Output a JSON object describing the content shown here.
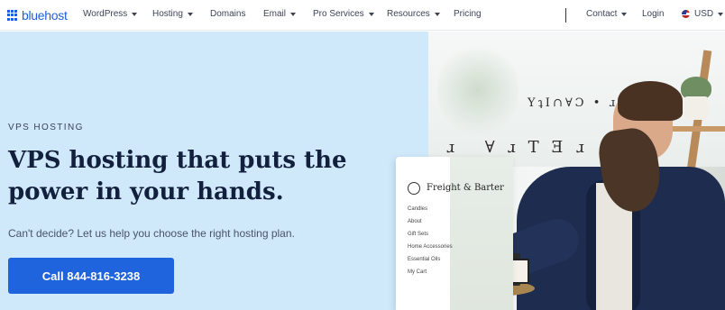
{
  "nav": {
    "logo_text": "bluehost",
    "items": [
      {
        "label": "WordPress",
        "dropdown": true
      },
      {
        "label": "Hosting",
        "dropdown": true
      },
      {
        "label": "Domains",
        "dropdown": false
      },
      {
        "label": "Email",
        "dropdown": true
      },
      {
        "label": "Pro Services",
        "dropdown": true
      },
      {
        "label": "Resources",
        "dropdown": true
      },
      {
        "label": "Pricing",
        "dropdown": false
      }
    ],
    "contact_label": "Contact",
    "login_label": "Login",
    "currency_label": "USD"
  },
  "hero": {
    "eyebrow": "VPS HOSTING",
    "headline": "VPS hosting that puts the power in your hands.",
    "subtext": "Can't decide? Let us help you choose the right hosting plan.",
    "cta_label": "Call 844-816-3238"
  },
  "photo": {
    "sign_line_1": "YʇI∩∀Ɔ • ɹO",
    "sign_line_2": "ɹ ∀ɹTƎɹ",
    "card": {
      "brand": "Freight & Barter",
      "links": [
        "Candles",
        "About",
        "Gift Sets",
        "Home Accessories",
        "Essential Oils",
        "My Cart"
      ]
    }
  },
  "colors": {
    "brand_blue": "#1f63dd",
    "hero_bg": "#cfe9fb",
    "headline": "#13203d"
  }
}
